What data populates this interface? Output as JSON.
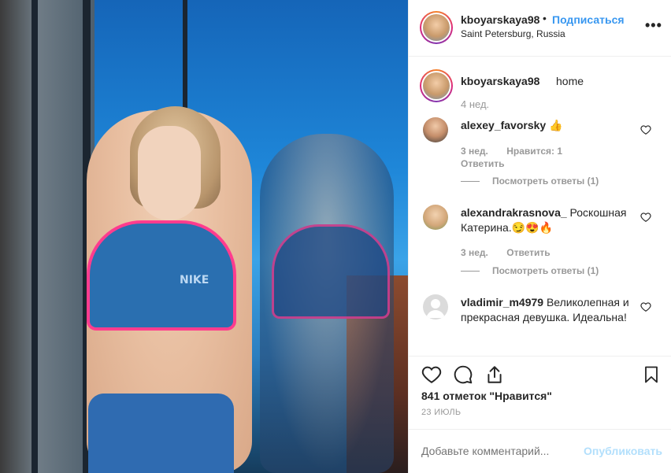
{
  "post": {
    "username": "kboyarskaya98",
    "separator": "•",
    "follow_label": "Подписаться",
    "location": "Saint Petersburg, Russia",
    "more_icon": "more-dots-icon",
    "photo_overlay": "NIKE"
  },
  "caption": {
    "username": "kboyarskaya98",
    "text": "home",
    "time": "4 нед."
  },
  "comments": [
    {
      "username": "alexey_favorsky",
      "text": "👍",
      "time": "3 нед.",
      "likes": "Нравится: 1",
      "reply_label": "Ответить",
      "view_replies": "Посмотреть ответы (1)"
    },
    {
      "username": "alexandrakrasnova_",
      "text": "Роскошная Катерина.😏😍🔥",
      "time": "3 нед.",
      "reply_label": "Ответить",
      "view_replies": "Посмотреть ответы (1)"
    },
    {
      "username": "vladimir_m4979",
      "text": "Великолепная и прекрасная девушка. Идеальна!"
    }
  ],
  "actions": {
    "like_icon": "heart-icon",
    "comment_icon": "comment-icon",
    "share_icon": "share-icon",
    "save_icon": "bookmark-icon"
  },
  "likes_text": "841 отметок \"Нравится\"",
  "date": "23 ИЮЛЬ",
  "add_comment": {
    "placeholder": "Добавьте комментарий...",
    "publish_label": "Опубликовать"
  },
  "colors": {
    "accent": "#3897f0",
    "publish_disabled": "#b2dffc",
    "muted": "#999999"
  }
}
